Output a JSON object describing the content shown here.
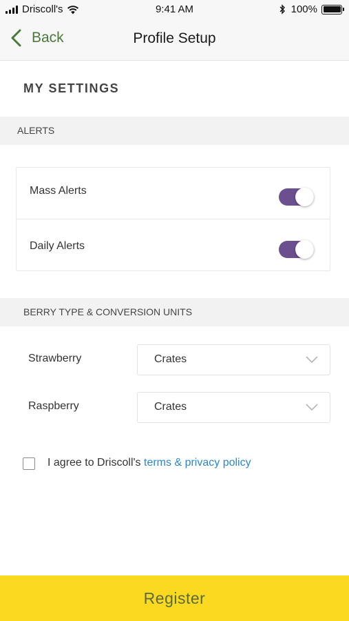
{
  "status_bar": {
    "carrier": "Driscoll's",
    "time": "9:41 AM",
    "battery_percent_text": "100%",
    "battery_level": 1.0,
    "icons": [
      "signal-icon",
      "wifi-icon",
      "bluetooth-icon",
      "battery-icon"
    ]
  },
  "nav": {
    "back_label": "Back",
    "title": "Profile Setup",
    "back_color": "#4a7a3a"
  },
  "page_title": "MY SETTINGS",
  "alerts": {
    "header": "ALERTS",
    "items": [
      {
        "label": "Mass Alerts",
        "enabled": true
      },
      {
        "label": "Daily Alerts",
        "enabled": true
      }
    ],
    "toggle_color": "#6b4f8f"
  },
  "berries": {
    "header": "BERRY TYPE & CONVERSION UNITS",
    "rows": [
      {
        "label": "Strawberry",
        "unit": "Crates"
      },
      {
        "label": "Raspberry",
        "unit": "Crates"
      }
    ]
  },
  "terms": {
    "checked": false,
    "prefix": "I agree to Driscoll's ",
    "link_text": "terms & privacy policy",
    "link_color": "#2e86c8"
  },
  "register": {
    "label": "Register",
    "background": "#fcd921"
  }
}
